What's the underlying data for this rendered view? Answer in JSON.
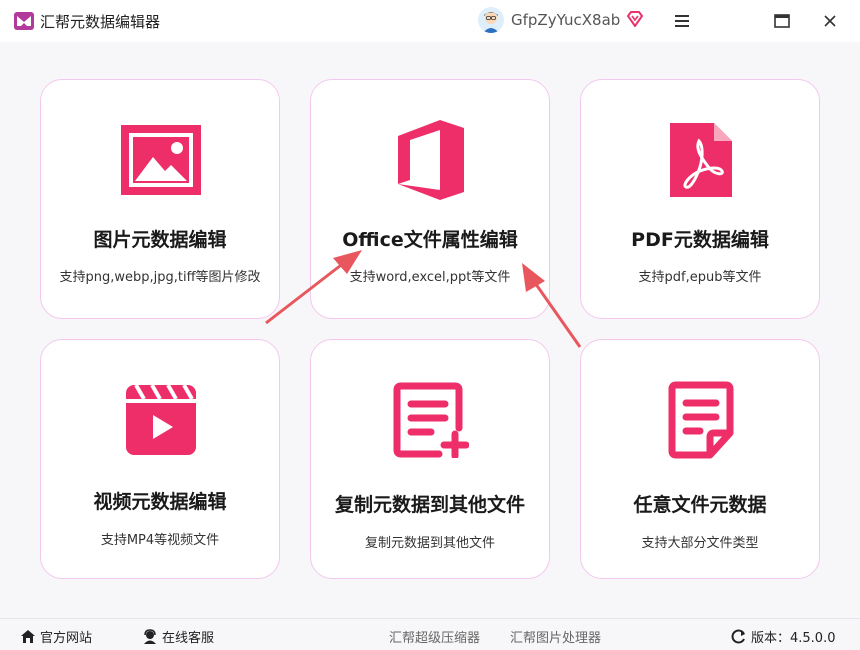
{
  "app": {
    "title": "汇帮元数据编辑器",
    "username": "GfpZyYucX8ab",
    "icons": {
      "logo": "app-logo-icon",
      "avatar": "user-avatar",
      "vip": "vip-diamond-icon",
      "menu": "hamburger-menu-icon",
      "maximize": "maximize-icon",
      "close": "close-icon"
    }
  },
  "colors": {
    "accent": "#ee2e68",
    "card_border": "#f3c8ee",
    "arrow": "#e8575e"
  },
  "cards": [
    {
      "title": "图片元数据编辑",
      "desc": "支持png,webp,jpg,tiff等图片修改",
      "icon": "image-icon"
    },
    {
      "title": "Office文件属性编辑",
      "desc": "支持word,excel,ppt等文件",
      "icon": "office-icon"
    },
    {
      "title": "PDF元数据编辑",
      "desc": "支持pdf,epub等文件",
      "icon": "pdf-icon"
    },
    {
      "title": "视频元数据编辑",
      "desc": "支持MP4等视频文件",
      "icon": "video-icon"
    },
    {
      "title": "复制元数据到其他文件",
      "desc": "复制元数据到其他文件",
      "icon": "document-add-icon"
    },
    {
      "title": "任意文件元数据",
      "desc": "支持大部分文件类型",
      "icon": "document-icon"
    }
  ],
  "footer": {
    "website": "官方网站",
    "support": "在线客服",
    "compressor": "汇帮超级压缩器",
    "image_processor": "汇帮图片处理器",
    "version": "版本：4.5.0.0"
  }
}
